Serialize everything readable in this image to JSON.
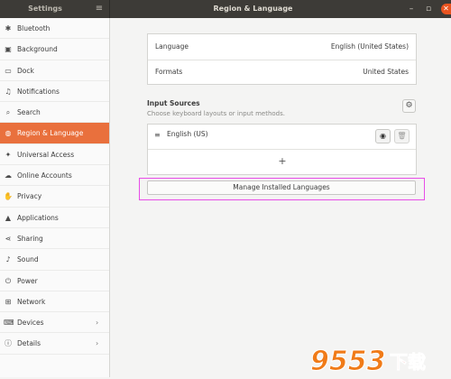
{
  "titlebar": {
    "left_title": "Settings",
    "right_title": "Region & Language",
    "menu_icon": "hamburger-icon",
    "minimize_icon": "minimize-icon",
    "maximize_icon": "maximize-icon",
    "close_icon": "close-icon"
  },
  "sidebar": {
    "items": [
      {
        "label": "Bluetooth",
        "icon": "bluetooth-icon"
      },
      {
        "label": "Background",
        "icon": "background-icon"
      },
      {
        "label": "Dock",
        "icon": "dock-icon"
      },
      {
        "label": "Notifications",
        "icon": "bell-icon"
      },
      {
        "label": "Search",
        "icon": "search-icon"
      },
      {
        "label": "Region & Language",
        "icon": "globe-icon",
        "active": true
      },
      {
        "label": "Universal Access",
        "icon": "accessibility-icon"
      },
      {
        "label": "Online Accounts",
        "icon": "cloud-icon"
      },
      {
        "label": "Privacy",
        "icon": "hand-icon"
      },
      {
        "label": "Applications",
        "icon": "applications-icon"
      },
      {
        "label": "Sharing",
        "icon": "share-icon"
      },
      {
        "label": "Sound",
        "icon": "music-note-icon"
      },
      {
        "label": "Power",
        "icon": "power-icon"
      },
      {
        "label": "Network",
        "icon": "network-icon"
      },
      {
        "label": "Devices",
        "icon": "devices-icon",
        "chevron": true
      },
      {
        "label": "Details",
        "icon": "info-icon",
        "chevron": true
      }
    ]
  },
  "main": {
    "language_label": "Language",
    "language_value": "English (United States)",
    "formats_label": "Formats",
    "formats_value": "United States",
    "input_sources_title": "Input Sources",
    "input_sources_subtitle": "Choose keyboard layouts or input methods.",
    "input_source_item": "English (US)",
    "add_label": "+",
    "manage_button": "Manage Installed Languages"
  },
  "watermark": {
    "text": "9553",
    "subtext": "下载",
    "colors": {
      "orange": "#f07b18",
      "red": "#d9261c"
    }
  },
  "colors": {
    "accent": "#e9703d",
    "titlebar": "#3d3b37",
    "highlight": "#e84de8"
  }
}
